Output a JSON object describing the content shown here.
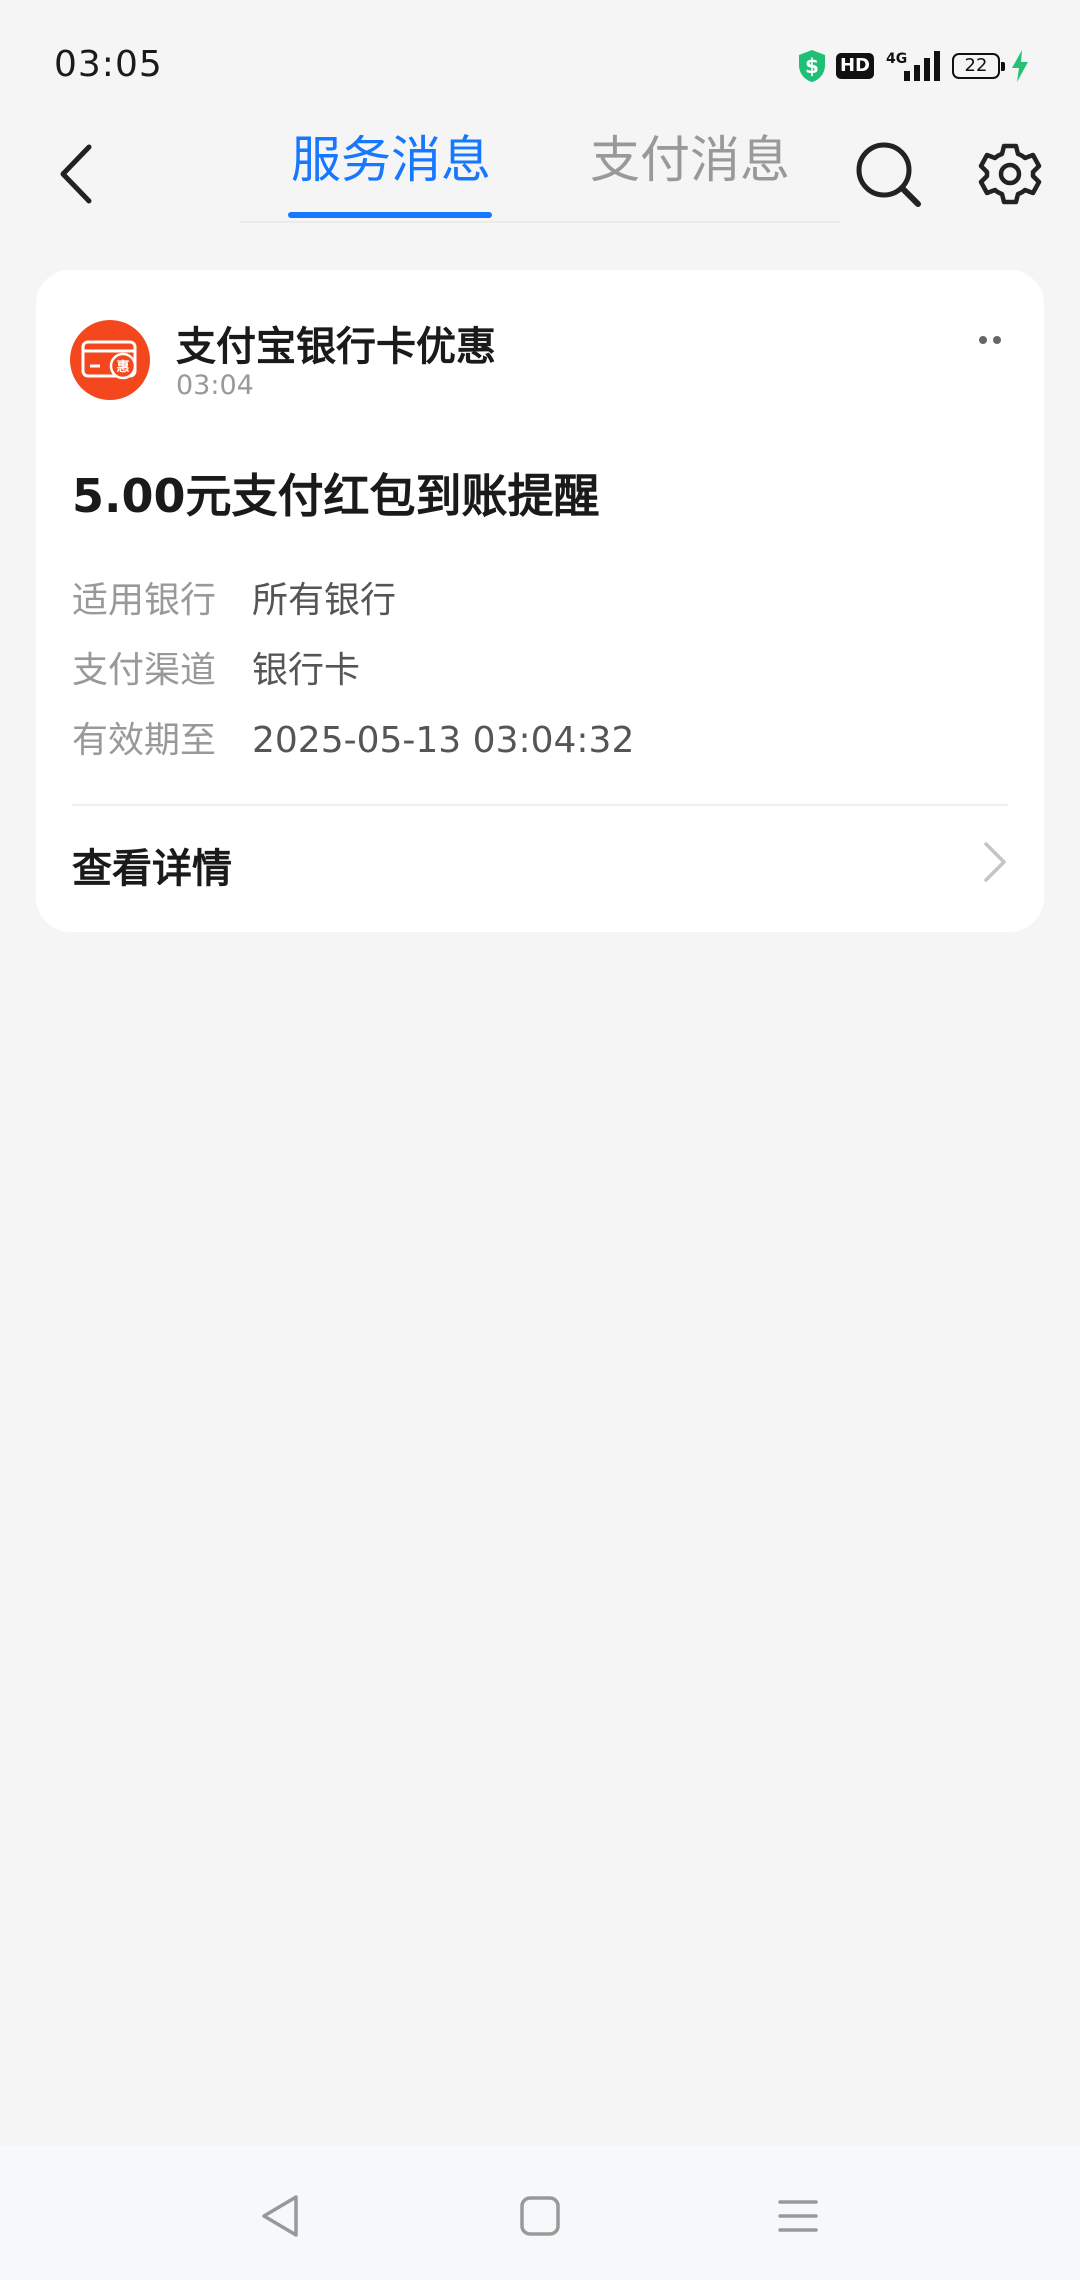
{
  "status_bar": {
    "time": "03:05",
    "hd_label": "HD",
    "network_label": "4G",
    "battery_level": "22",
    "icons": [
      "shield-dollar-icon",
      "hd-icon",
      "signal-4g-icon",
      "battery-icon",
      "charging-icon"
    ]
  },
  "nav": {
    "back_icon": "chevron-left-icon",
    "tabs": [
      {
        "label": "服务消息",
        "active": true
      },
      {
        "label": "支付消息",
        "active": false
      }
    ],
    "search_icon": "search-icon",
    "settings_icon": "gear-icon"
  },
  "card": {
    "title": "支付宝银行卡优惠",
    "time": "03:04",
    "avatar_icon": "bank-card-discount-icon",
    "avatar_badge": "惠",
    "message_title": "5.00元支付红包到账提醒",
    "details": [
      {
        "label": "适用银行",
        "value": "所有银行"
      },
      {
        "label": "支付渠道",
        "value": "银行卡"
      },
      {
        "label": "有效期至",
        "value": "2025-05-13 03:04:32"
      }
    ],
    "action_label": "查看详情"
  },
  "colors": {
    "accent": "#1677ff",
    "avatar": "#f5471d",
    "background": "#f5f5f5",
    "shield": "#1fbf75",
    "charging": "#25c274"
  }
}
